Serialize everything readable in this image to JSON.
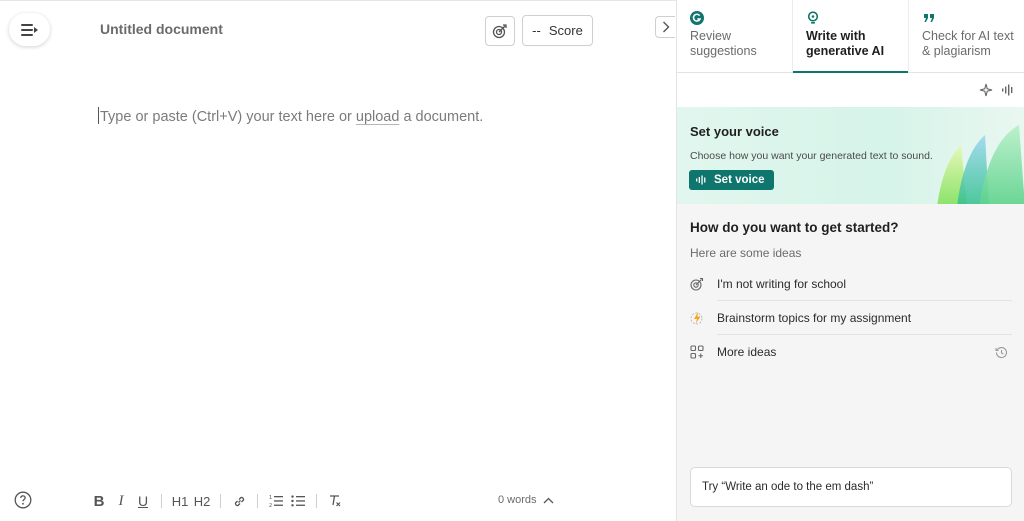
{
  "editor": {
    "title": "Untitled document",
    "score_prefix": "--",
    "score_label": "Score",
    "placeholder_before": "Type or paste (Ctrl+V) your text here or ",
    "placeholder_link": "upload",
    "placeholder_after": " a document.",
    "word_count": "0 words",
    "toolbar": {
      "bold": "B",
      "italic": "I",
      "underline": "U",
      "h1": "H1",
      "h2": "H2"
    }
  },
  "panel": {
    "tabs": [
      {
        "label": "Review suggestions",
        "icon": "grammarly-g-icon",
        "active": false
      },
      {
        "label": "Write with generative AI",
        "icon": "bulb-icon",
        "active": true
      },
      {
        "label": "Check for AI text & plagiarism",
        "icon": "quote-icon",
        "active": false
      }
    ],
    "voice": {
      "title": "Set your voice",
      "description": "Choose how you want your generated text to sound.",
      "button_label": "Set voice"
    },
    "start": {
      "title": "How do you want to get started?",
      "ideas_label": "Here are some ideas",
      "ideas": [
        {
          "label": "I'm not writing for school",
          "icon": "target-icon"
        },
        {
          "label": "Brainstorm topics for my assignment",
          "icon": "lightning-icon"
        },
        {
          "label": "More ideas",
          "icon": "grid-plus-icon"
        }
      ]
    },
    "prompt_hint": "Try “Write an ode to the em dash”"
  },
  "colors": {
    "accent": "#0f766e",
    "voice_card_bg": "#d6f4e9"
  }
}
